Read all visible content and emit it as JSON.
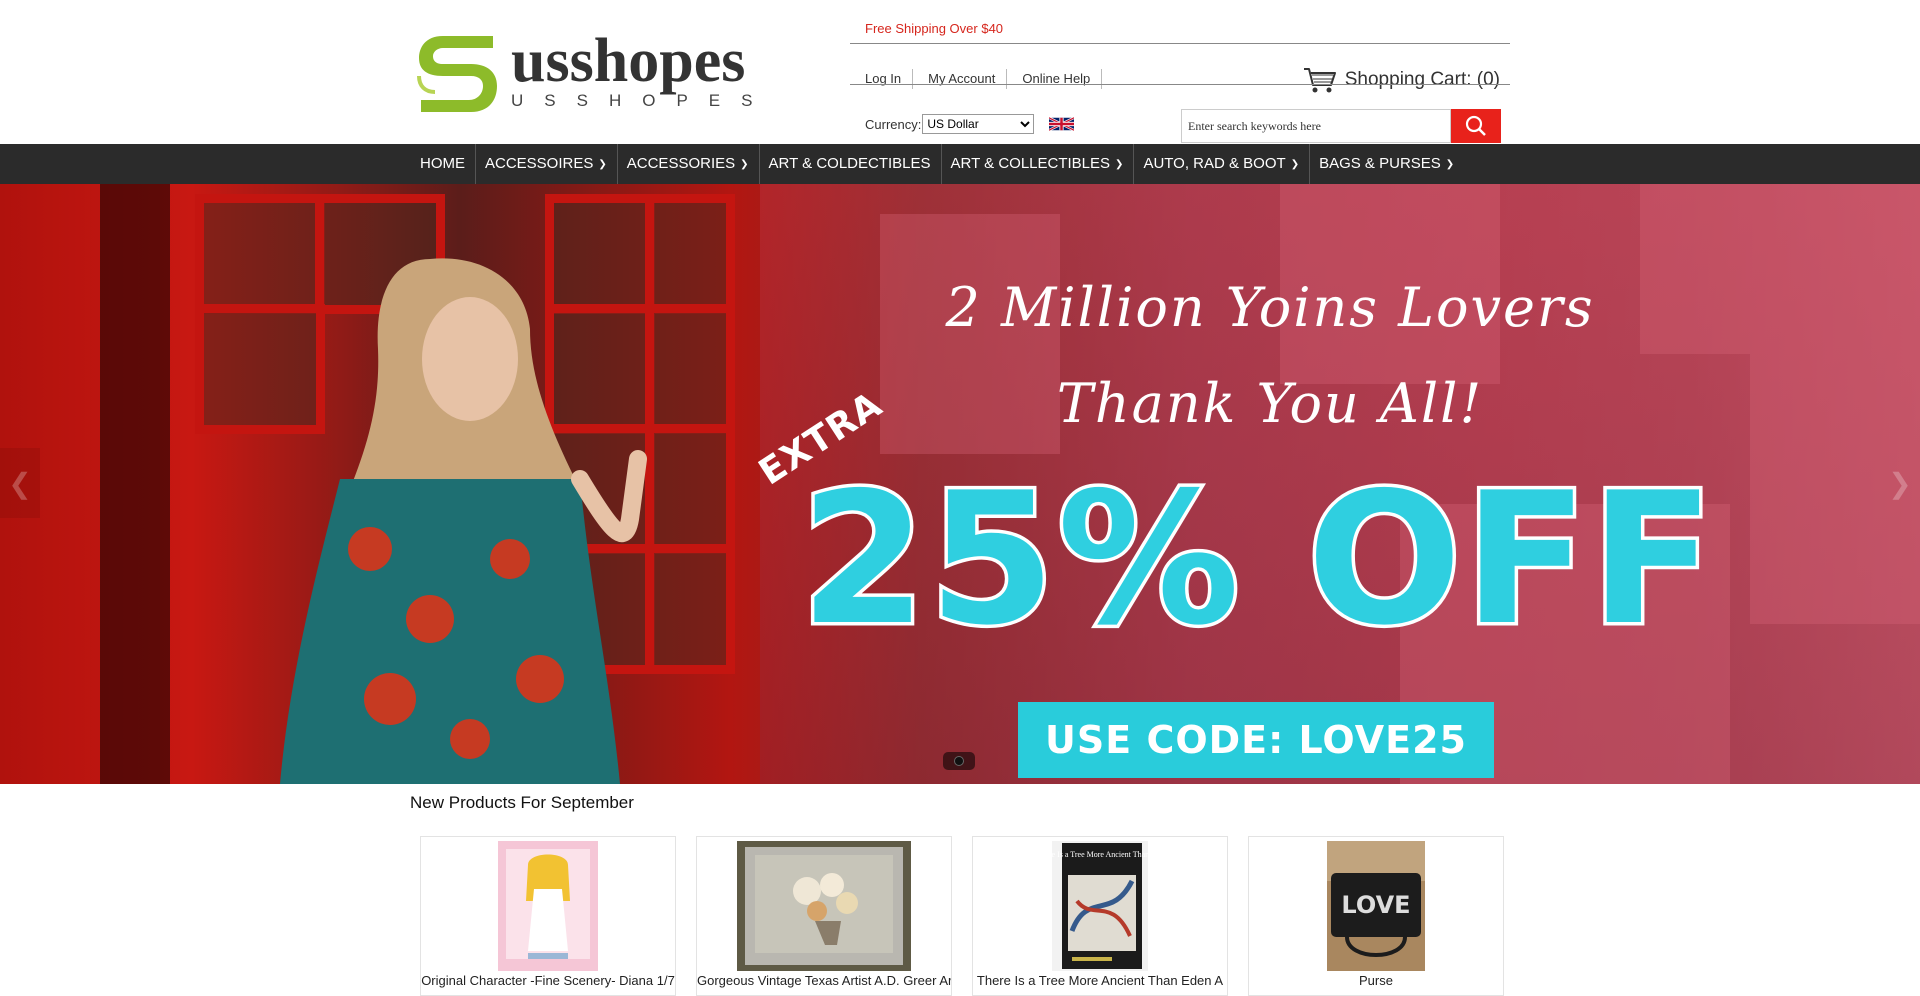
{
  "brand": {
    "name": "usshopes",
    "subtitle": "USSHOPES",
    "accent_green": "#8dbb2a",
    "accent_red": "#e8221b"
  },
  "topbar": {
    "promo": "Free Shipping Over $40",
    "links": [
      "Log In",
      "My Account",
      "Online Help"
    ],
    "cart_label": "Shopping Cart: (0)",
    "currency_label": "Currency:",
    "currency_selected": "US Dollar",
    "search_placeholder": "Enter search keywords here"
  },
  "nav": {
    "items": [
      {
        "label": "HOME",
        "dropdown": false
      },
      {
        "label": "ACCESSOIRES",
        "dropdown": true
      },
      {
        "label": "ACCESSORIES",
        "dropdown": true
      },
      {
        "label": "ART & COLDECTIBLES",
        "dropdown": false
      },
      {
        "label": "ART & COLLECTIBLES",
        "dropdown": true
      },
      {
        "label": "AUTO, RAD & BOOT",
        "dropdown": true
      },
      {
        "label": "BAGS & PURSES",
        "dropdown": true
      }
    ],
    "background": "#2b2b2b"
  },
  "banner": {
    "headline_1": "2 Million Yoins Lovers",
    "headline_2": "Thank You All!",
    "extra": "EXTRA",
    "discount": "25% OFF",
    "code": "USE CODE: LOVE25",
    "cyan": "#29ccdb"
  },
  "section": {
    "title": "New Products For September"
  },
  "products": [
    {
      "title": "Original Character -Fine Scenery- Diana 1/7"
    },
    {
      "title": "Gorgeous Vintage Texas Artist A.D. Greer Art"
    },
    {
      "title": "There Is a Tree More Ancient Than Eden A"
    },
    {
      "title": "Purse"
    }
  ],
  "product_images": {
    "book_title": "There Is a Tree More Ancient Than Eden",
    "bag_text": "LOVE"
  }
}
